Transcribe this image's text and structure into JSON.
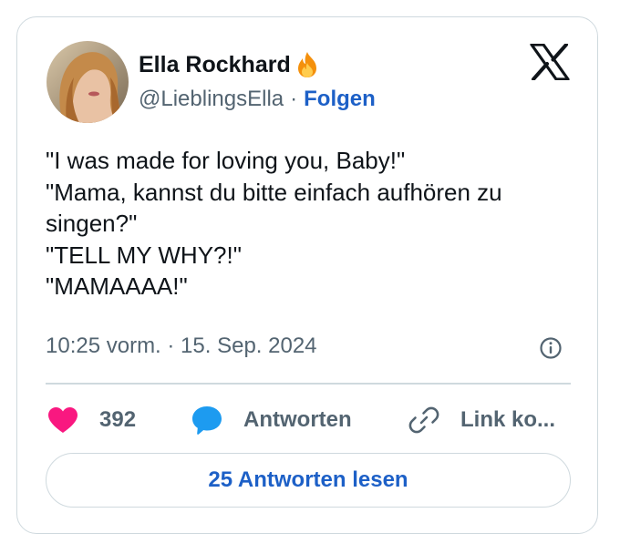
{
  "author": {
    "name": "Ella Rockhard",
    "emoji_icon": "fire-icon",
    "handle": "@LieblingsElla",
    "separator": "·",
    "follow_label": "Folgen"
  },
  "platform_icon": "x-logo-icon",
  "tweet": {
    "lines": [
      "\"I was made for loving you, Baby!\"",
      "\"Mama, kannst du bitte einfach aufhören zu singen?\"",
      "\"TELL MY WHY?!\"",
      "\"MAMAAAA!\""
    ]
  },
  "meta": {
    "timestamp": "10:25 vorm. · 15. Sep. 2024",
    "info_icon": "info-icon"
  },
  "actions": {
    "like_count": "392",
    "reply_label": "Antworten",
    "link_label": "Link ko..."
  },
  "read_replies_label": "25 Antworten lesen",
  "colors": {
    "accent": "#1d60c7",
    "like": "#f91880",
    "reply": "#1d9bf0",
    "text": "#0f1419",
    "muted": "#536471",
    "border": "#cfd9de"
  }
}
